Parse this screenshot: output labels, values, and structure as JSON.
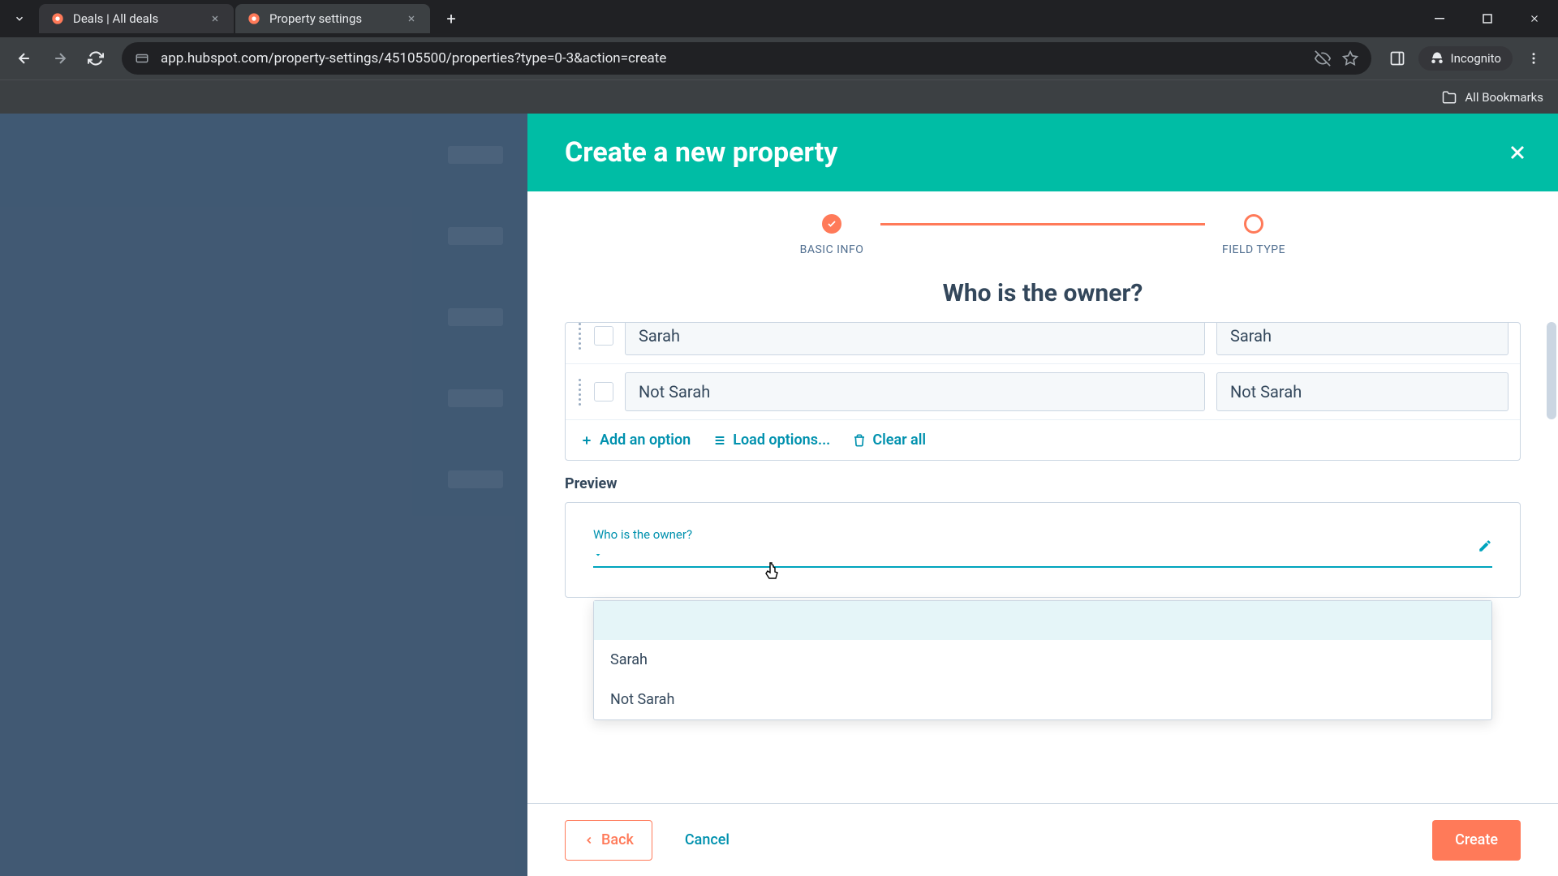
{
  "browser": {
    "tabs": [
      {
        "title": "Deals | All deals",
        "active": false
      },
      {
        "title": "Property settings",
        "active": true
      }
    ],
    "url": "app.hubspot.com/property-settings/45105500/properties?type=0-3&action=create",
    "incognito_label": "Incognito",
    "all_bookmarks_label": "All Bookmarks"
  },
  "modal": {
    "title": "Create a new property",
    "steps": [
      {
        "label": "BASIC INFO",
        "state": "done"
      },
      {
        "label": "FIELD TYPE",
        "state": "current"
      }
    ],
    "question": "Who is the owner?",
    "options": [
      {
        "label": "Sarah",
        "internal": "Sarah"
      },
      {
        "label": "Not Sarah",
        "internal": "Not Sarah"
      }
    ],
    "actions": {
      "add_option": "Add an option",
      "load_options": "Load options...",
      "clear_all": "Clear all"
    },
    "preview": {
      "section_label": "Preview",
      "field_label": "Who is the owner?",
      "dropdown_items": [
        "",
        "Sarah",
        "Not Sarah"
      ]
    },
    "footer": {
      "back": "Back",
      "cancel": "Cancel",
      "create": "Create"
    }
  }
}
